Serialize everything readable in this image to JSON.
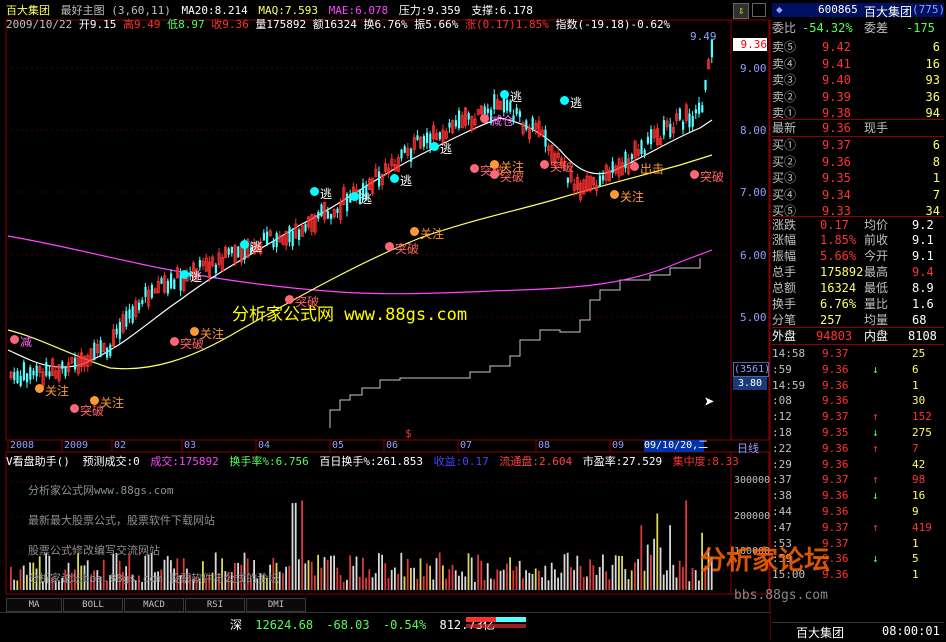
{
  "header": {
    "stock_name": "百大集团",
    "formula": "最好主图",
    "params": "(3,60,11)",
    "ma20": "MA20:8.214",
    "maq": "MAQ:7.593",
    "mae": "MAE:6.078",
    "pressure": "压力:9.359",
    "support": "支撑:6.178",
    "date": "2009/10/22",
    "open": "开9.15",
    "high": "高9.49",
    "low": "低8.97",
    "close": "收9.36",
    "volume": "量175892",
    "amount": "额16324",
    "turnover": "换6.76%",
    "amplitude": "振5.66%",
    "change": "涨(0.17)1.85%",
    "index": "指数(-19.18)-0.62%"
  },
  "price_axis": {
    "labels": [
      "9.49",
      "9.00",
      "8.00",
      "7.00",
      "6.00",
      "5.00"
    ],
    "current": "9.36",
    "box1": "(3561)",
    "box2": "3.80"
  },
  "timeline": {
    "labels": [
      "2008",
      "2009",
      "02",
      "03",
      "04",
      "05",
      "06",
      "07",
      "08",
      "09"
    ],
    "highlight": "09/10/20,二",
    "period": "日线",
    "marker": "$"
  },
  "annotations": {
    "watermark": "分析家公式网 www.88gs.com",
    "signals": [
      {
        "text": "关注",
        "color": "#ff9933"
      },
      {
        "text": "突破",
        "color": "#ff6666"
      },
      {
        "text": "关注",
        "color": "#ff9933"
      },
      {
        "text": "突破",
        "color": "#ff6666"
      },
      {
        "text": "关注",
        "color": "#ff9933"
      },
      {
        "text": "突破",
        "color": "#ff6666"
      },
      {
        "text": "突破",
        "color": "#ff6666"
      },
      {
        "text": "关注",
        "color": "#ff9933"
      },
      {
        "text": "突破",
        "color": "#ff6666"
      },
      {
        "text": "关注",
        "color": "#ff9933"
      },
      {
        "text": "突破",
        "color": "#ff6666"
      },
      {
        "text": "突破",
        "color": "#ff6666"
      },
      {
        "text": "关注",
        "color": "#ff9933"
      },
      {
        "text": "突破",
        "color": "#ff6666"
      },
      {
        "text": "逃",
        "color": "#ffffff"
      },
      {
        "text": "逃",
        "color": "#ffffff"
      },
      {
        "text": "逃",
        "color": "#ffffff"
      },
      {
        "text": "逃",
        "color": "#ffffff"
      },
      {
        "text": "逃",
        "color": "#ffffff"
      },
      {
        "text": "逃",
        "color": "#ffffff"
      },
      {
        "text": "逃",
        "color": "#ffffff"
      },
      {
        "text": "逃",
        "color": "#ffffff"
      },
      {
        "text": "减仓",
        "color": "#ff66ff"
      },
      {
        "text": "出击",
        "color": "#ff9933"
      },
      {
        "text": "减",
        "color": "#ff66ff"
      }
    ]
  },
  "lower_panel": {
    "title": "V看盘助手()",
    "forecast": "预测成交:0",
    "volume": "成交:175892",
    "turnover": "换手率%:6.756",
    "hundred_day": "百日换手%:261.853",
    "income": "收益:0.17",
    "circulation": "流通盘:2.604",
    "pe": "市盈率:27.529",
    "concentration": "集中度:8.33",
    "axis": [
      "300000",
      "200000",
      "100000"
    ],
    "ads": [
      "分析家公式网www.88gs.com",
      "最新最大股票公式，股票软件下载网站",
      "股票公式修改编写交流网站",
      "分析家论坛bbs.88gs.com 股票软件与公式的论坛"
    ]
  },
  "buttons": [
    "MA",
    "BOLL",
    "MACD",
    "RSI",
    "DMI"
  ],
  "status_bar": {
    "index_label": "深",
    "index_value": "12624.68",
    "index_change": "-68.03",
    "index_pct": "-0.54%",
    "index_amount": "812.73亿"
  },
  "right_panel": {
    "code": "600865",
    "name": "百大集团",
    "tag": "(775)",
    "weibi": "委比",
    "weibi_val": "-54.32%",
    "weicha": "委差",
    "weicha_val": "-175",
    "sells": [
      {
        "label": "卖⑤",
        "price": "9.42",
        "vol": "6"
      },
      {
        "label": "卖④",
        "price": "9.41",
        "vol": "16"
      },
      {
        "label": "卖③",
        "price": "9.40",
        "vol": "93"
      },
      {
        "label": "卖②",
        "price": "9.39",
        "vol": "36"
      },
      {
        "label": "卖①",
        "price": "9.38",
        "vol": "94"
      }
    ],
    "latest": {
      "label": "最新",
      "val": "9.36",
      "label2": "现手",
      "val2": ""
    },
    "buys": [
      {
        "label": "买①",
        "price": "9.37",
        "vol": "6"
      },
      {
        "label": "买②",
        "price": "9.36",
        "vol": "8"
      },
      {
        "label": "买③",
        "price": "9.35",
        "vol": "1"
      },
      {
        "label": "买④",
        "price": "9.34",
        "vol": "7"
      },
      {
        "label": "买⑤",
        "price": "9.33",
        "vol": "34"
      }
    ],
    "stats": [
      {
        "l1": "涨跌",
        "v1": "0.17",
        "l2": "均价",
        "v2": "9.2"
      },
      {
        "l1": "涨幅",
        "v1": "1.85%",
        "l2": "前收",
        "v2": "9.1"
      },
      {
        "l1": "振幅",
        "v1": "5.66%",
        "l2": "今开",
        "v2": "9.1"
      },
      {
        "l1": "总手",
        "v1": "175892",
        "l2": "最高",
        "v2": "9.4"
      },
      {
        "l1": "总额",
        "v1": "16324",
        "l2": "最低",
        "v2": "8.9"
      },
      {
        "l1": "换手",
        "v1": "6.76%",
        "l2": "量比",
        "v2": "1.6"
      },
      {
        "l1": "分笔",
        "v1": "257",
        "l2": "均量",
        "v2": "68"
      }
    ],
    "outer": {
      "l1": "外盘",
      "v1": "94803",
      "l2": "内盘",
      "v2": "8108"
    },
    "ticks": [
      {
        "time": "14:58",
        "price": "9.37",
        "arrow": "",
        "vol": "25"
      },
      {
        "time": ":59",
        "price": "9.36",
        "arrow": "↓",
        "vol": "6"
      },
      {
        "time": "14:59",
        "price": "9.36",
        "arrow": "",
        "vol": "1"
      },
      {
        "time": ":08",
        "price": "9.36",
        "arrow": "",
        "vol": "30"
      },
      {
        "time": ":12",
        "price": "9.37",
        "arrow": "↑",
        "vol": "152"
      },
      {
        "time": ":18",
        "price": "9.35",
        "arrow": "↓",
        "vol": "275"
      },
      {
        "time": ":22",
        "price": "9.36",
        "arrow": "↑",
        "vol": "7"
      },
      {
        "time": ":29",
        "price": "9.36",
        "arrow": "",
        "vol": "42"
      },
      {
        "time": ":37",
        "price": "9.37",
        "arrow": "↑",
        "vol": "98"
      },
      {
        "time": ":38",
        "price": "9.36",
        "arrow": "↓",
        "vol": "16"
      },
      {
        "time": ":44",
        "price": "9.36",
        "arrow": "",
        "vol": "9"
      },
      {
        "time": ":47",
        "price": "9.37",
        "arrow": "↑",
        "vol": "419"
      },
      {
        "time": ":53",
        "price": "9.37",
        "arrow": "",
        "vol": "1"
      },
      {
        "time": ":59",
        "price": "9.36",
        "arrow": "↓",
        "vol": "5"
      },
      {
        "time": "15:00",
        "price": "9.36",
        "arrow": "",
        "vol": "1"
      }
    ],
    "watermark": "分析家论坛",
    "watermark_url": "bbs.88gs.com",
    "bottom_name": "百大集团",
    "bottom_time": "08:00:01"
  },
  "colors": {
    "up": "#ff3232",
    "down": "#54ffff",
    "ma_white": "#ffffff",
    "ma_yellow": "#ffff66",
    "ma_magenta": "#ff44ff",
    "step": "#c8c8c8",
    "grid": "#c00000"
  }
}
